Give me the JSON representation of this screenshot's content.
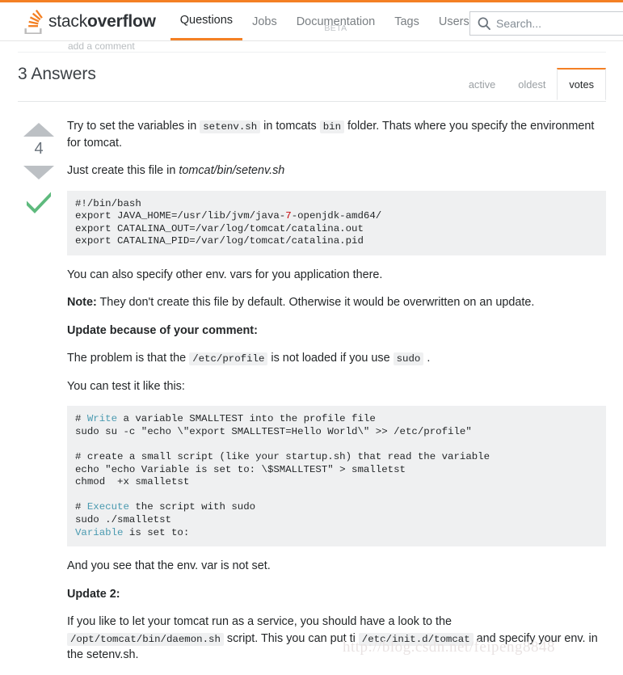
{
  "header": {
    "logo_text_light": "stack",
    "logo_text_bold": "overflow",
    "logo_icon": "stackoverflow-logo-icon",
    "nav": [
      {
        "label": "Questions",
        "active": true,
        "beta": ""
      },
      {
        "label": "Jobs",
        "active": false,
        "beta": ""
      },
      {
        "label": "Documentation",
        "active": false,
        "beta": "BETA"
      },
      {
        "label": "Tags",
        "active": false,
        "beta": ""
      },
      {
        "label": "Users",
        "active": false,
        "beta": ""
      }
    ],
    "search": {
      "icon": "search-icon",
      "placeholder": "Search...",
      "value": ""
    }
  },
  "behind_header": {
    "add_comment_label": "add a comment"
  },
  "answers": {
    "title": "3 Answers",
    "tabs": [
      {
        "label": "active",
        "active": false
      },
      {
        "label": "oldest",
        "active": false
      },
      {
        "label": "votes",
        "active": true
      }
    ]
  },
  "answer": {
    "vote_count": "4",
    "upvote_icon": "arrow-up-icon",
    "downvote_icon": "arrow-down-icon",
    "accepted_icon": "checkmark-icon",
    "p1_a": "Try to set the variables in ",
    "p1_code1": "setenv.sh",
    "p1_b": " in tomcats ",
    "p1_code2": "bin",
    "p1_c": " folder. Thats where you specify the environment for tomcat.",
    "p2_a": "Just create this file in ",
    "p2_em": "tomcat/bin/setenv.sh",
    "code1": "#!/bin/bash\nexport JAVA_HOME=/usr/lib/jvm/java-§7§-openjdk-amd64/\nexport CATALINA_OUT=/var/log/tomcat/catalina.out\nexport CATALINA_PID=/var/log/tomcat/catalina.pid",
    "p3": "You can also specify other env. vars for you application there.",
    "p4_label": "Note:",
    "p4_text": " They don't create this file by default. Otherwise it would be overwritten on an update.",
    "p5_heading": "Update because of your comment:",
    "p6_a": "The problem is that the ",
    "p6_code1": "/etc/profile",
    "p6_b": " is not loaded if you use ",
    "p6_code2": "sudo",
    "p6_c": " .",
    "p7": "You can test it like this:",
    "code2_line1_hash": "# ",
    "code2_line1_kw": "Write",
    "code2_line1_rest": " a variable SMALLTEST into the profile file",
    "code2_line2": "sudo su -c \"echo \\\"export SMALLTEST=Hello World\\\" >> /etc/profile\"",
    "code2_line3": "",
    "code2_line4": "# create a small script (like your startup.sh) that read the variable",
    "code2_line5": "echo \"echo Variable is set to: \\$SMALLTEST\" > smalletst",
    "code2_line6": "chmod  +x smalletst",
    "code2_line7": "",
    "code2_line8_hash": "# ",
    "code2_line8_kw": "Execute",
    "code2_line8_rest": " the script with sudo",
    "code2_line9": "sudo ./smalletst",
    "code2_line10_kw": "Variable",
    "code2_line10_rest": " is set to:",
    "p8": "And you see that the env. var is not set.",
    "p9_heading": "Update 2:",
    "p10_a": "If you like to let your tomcat run as a service, you should have a look to the ",
    "p10_code1": "/opt/tomcat/bin/daemon.sh",
    "p10_b": " script. This you can put ti ",
    "p10_code2": "/etc/init.d/tomcat",
    "p10_c": " and specify your env. in the setenv.sh."
  },
  "watermark": {
    "text": "http://blog.csdn.net/feipeng8848"
  },
  "colors": {
    "accent_orange": "#f48024",
    "code_bg": "#eff0f1",
    "accepted_green": "#48a868",
    "vote_arrow_gray": "#bcc0c4"
  }
}
